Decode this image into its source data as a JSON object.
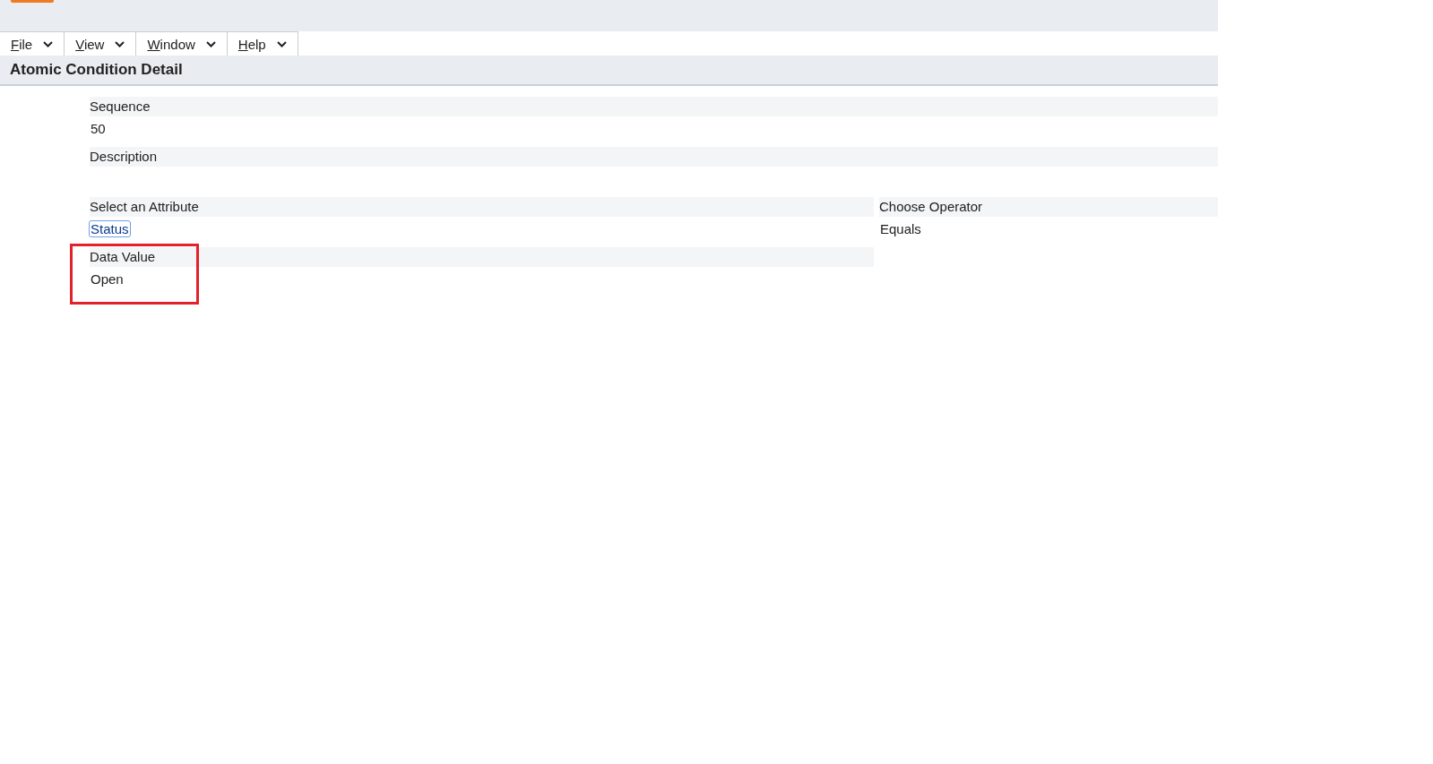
{
  "menu": [
    {
      "label": "File"
    },
    {
      "label": "View"
    },
    {
      "label": "Window"
    },
    {
      "label": "Help"
    }
  ],
  "panel": {
    "title": "Atomic Condition Detail"
  },
  "fields": [
    {
      "label": "Sequence",
      "value": "50"
    },
    {
      "label": "Description"
    }
  ],
  "attribute": {
    "label": "Select an Attribute",
    "value": "Status",
    "focused": true
  },
  "operator": {
    "label": "Choose Operator",
    "value": "Equals"
  },
  "data_value": {
    "label": "Data Value",
    "value": "Open",
    "highlighted": true
  }
}
